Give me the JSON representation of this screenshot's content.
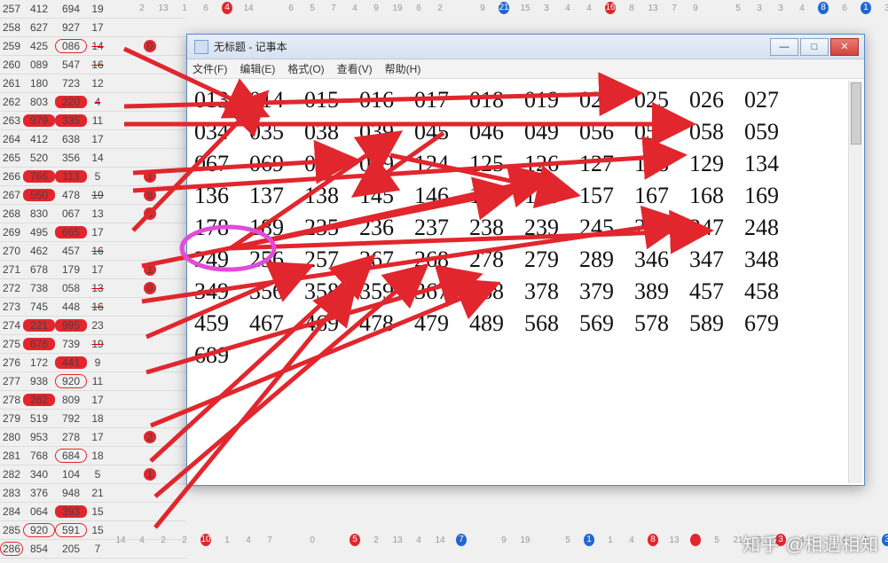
{
  "window": {
    "title": "无标题 - 记事本",
    "buttons": {
      "min": "—",
      "max": "□",
      "close": "✕"
    }
  },
  "menu": {
    "file": "文件(F)",
    "edit": "编辑(E)",
    "format": "格式(O)",
    "view": "查看(V)",
    "help": "帮助(H)"
  },
  "notepad_lines": [
    [
      "013",
      "014",
      "015",
      "016",
      "017",
      "018",
      "019",
      "023",
      "025",
      "026",
      "027"
    ],
    [
      "034",
      "035",
      "038",
      "039",
      "045",
      "046",
      "049",
      "056",
      "057",
      "058",
      "059"
    ],
    [
      "067",
      "069",
      "078",
      "089",
      "124",
      "125",
      "126",
      "127",
      "128",
      "129",
      "134"
    ],
    [
      "136",
      "137",
      "138",
      "145",
      "146",
      "149",
      "156",
      "157",
      "167",
      "168",
      "169"
    ],
    [
      "178",
      "189",
      "235",
      "236",
      "237",
      "238",
      "239",
      "245",
      "246",
      "247",
      "248"
    ],
    [
      "249",
      "256",
      "257",
      "267",
      "268",
      "278",
      "279",
      "289",
      "346",
      "347",
      "348"
    ],
    [
      "349",
      "356",
      "358",
      "359",
      "367",
      "368",
      "378",
      "379",
      "389",
      "457",
      "458"
    ],
    [
      "459",
      "467",
      "469",
      "478",
      "479",
      "489",
      "568",
      "569",
      "578",
      "589",
      "679"
    ],
    [
      "689"
    ]
  ],
  "left_rows": [
    {
      "id": "257",
      "a": "412",
      "b": "694",
      "c": "19"
    },
    {
      "id": "258",
      "a": "627",
      "b": "927",
      "c": "17"
    },
    {
      "id": "259",
      "a": "425",
      "b": "086",
      "c": "14",
      "circ_b": true,
      "strike_c": true,
      "badge": "0"
    },
    {
      "id": "260",
      "a": "089",
      "b": "547",
      "c": "16",
      "strike_c": true
    },
    {
      "id": "261",
      "a": "180",
      "b": "723",
      "c": "12"
    },
    {
      "id": "262",
      "a": "803",
      "b": "220",
      "c": "4",
      "pill_b": true,
      "strike_c": true
    },
    {
      "id": "263",
      "a": "979",
      "b": "335",
      "c": "11",
      "pill_a": true,
      "pill_b": true
    },
    {
      "id": "264",
      "a": "412",
      "b": "638",
      "c": "17"
    },
    {
      "id": "265",
      "a": "520",
      "b": "356",
      "c": "14"
    },
    {
      "id": "266",
      "a": "766",
      "b": "113",
      "c": "5",
      "pill_a": true,
      "pill_b": true,
      "badge": "1"
    },
    {
      "id": "267",
      "a": "550",
      "b": "478",
      "c": "19",
      "pill_a": true,
      "strike_c": true,
      "badge": "8"
    },
    {
      "id": "268",
      "a": "830",
      "b": "067",
      "c": "13",
      "badge": "0"
    },
    {
      "id": "269",
      "a": "495",
      "b": "665",
      "c": "17",
      "pill_b": true
    },
    {
      "id": "270",
      "a": "462",
      "b": "457",
      "c": "16",
      "strike_c": true
    },
    {
      "id": "271",
      "a": "678",
      "b": "179",
      "c": "17",
      "badge": "1"
    },
    {
      "id": "272",
      "a": "738",
      "b": "058",
      "c": "13",
      "strike_c": true,
      "badge": "0"
    },
    {
      "id": "273",
      "a": "745",
      "b": "448",
      "c": "16",
      "strike_c": true
    },
    {
      "id": "274",
      "a": "221",
      "b": "995",
      "c": "23",
      "pill_a": true,
      "pill_b": true
    },
    {
      "id": "275",
      "a": "676",
      "b": "739",
      "c": "19",
      "pill_a": true,
      "strike_c": true
    },
    {
      "id": "276",
      "a": "172",
      "b": "441",
      "c": "9",
      "pill_b": true
    },
    {
      "id": "277",
      "a": "938",
      "b": "920",
      "c": "11",
      "circ_b": true
    },
    {
      "id": "278",
      "a": "262",
      "b": "809",
      "c": "17",
      "pill_a": true
    },
    {
      "id": "279",
      "a": "519",
      "b": "792",
      "c": "18"
    },
    {
      "id": "280",
      "a": "953",
      "b": "278",
      "c": "17",
      "badge": "2"
    },
    {
      "id": "281",
      "a": "768",
      "b": "684",
      "c": "18",
      "circ_b": true
    },
    {
      "id": "282",
      "a": "340",
      "b": "104",
      "c": "5",
      "badge": "1"
    },
    {
      "id": "283",
      "a": "376",
      "b": "948",
      "c": "21"
    },
    {
      "id": "284",
      "a": "064",
      "b": "393",
      "c": "15",
      "pill_b": true
    },
    {
      "id": "285",
      "a": "920",
      "b": "591",
      "c": "15",
      "circ_a": true,
      "circ_b": true
    },
    {
      "id": "286",
      "a": "854",
      "b": "205",
      "c": "7",
      "circ_id": true
    }
  ],
  "top_strip": [
    "",
    "2",
    "13",
    "1",
    "6",
    "4",
    "14",
    "",
    "6",
    "5",
    "7",
    "4",
    "9",
    "19",
    "6",
    "2",
    "",
    "9",
    "21",
    "15",
    "3",
    "4",
    "4",
    "16",
    "8",
    "13",
    "7",
    "9",
    "",
    "5",
    "3",
    "3",
    "4",
    "8",
    "6",
    "1",
    "3"
  ],
  "bottom_strip": [
    "14",
    "4",
    "2",
    "2",
    "10",
    "1",
    "4",
    "7",
    "",
    "0",
    "",
    "5",
    "2",
    "13",
    "4",
    "14",
    "7",
    "",
    "9",
    "19",
    "",
    "5",
    "1",
    "1",
    "4",
    "8",
    "13",
    "",
    "5",
    "21",
    "5",
    "3",
    "4",
    "",
    "6",
    "1",
    "3"
  ],
  "dot_marks_top": {
    "5": "red",
    "18": "blue",
    "23": "red",
    "33": "blue",
    "35": "blue"
  },
  "dot_marks_bottom": {
    "4": "red",
    "11": "red",
    "16": "blue",
    "22": "blue",
    "25": "red",
    "27": "red",
    "31": "red",
    "36": "blue"
  },
  "watermark": "知乎 @相遇相知"
}
